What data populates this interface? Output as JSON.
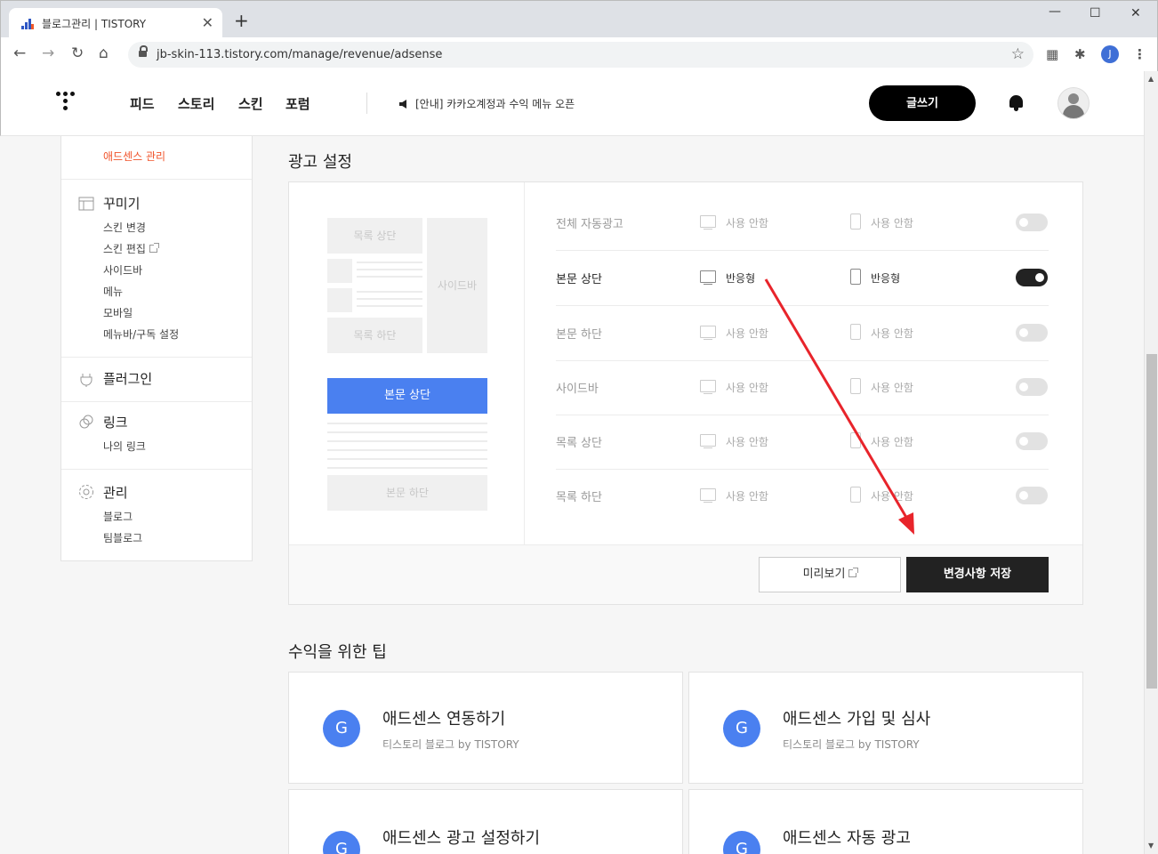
{
  "browser": {
    "tab_title": "블로그관리 | TISTORY",
    "tab_close": "✕",
    "new_tab": "+",
    "url": "jb-skin-113.tistory.com/manage/revenue/adsense",
    "profile_initial": "J",
    "minimize": "—",
    "maximize": "☐",
    "close": "✕"
  },
  "header": {
    "nav": [
      "피드",
      "스토리",
      "스킨",
      "포럼"
    ],
    "notice": "[안내] 카카오계정과 수익 메뉴 오픈",
    "write_button": "글쓰기"
  },
  "sidebar": {
    "active_item": "애드센스 관리",
    "sections": [
      {
        "title": "꾸미기",
        "icon": "layout-icon",
        "items": [
          "스킨 변경",
          "스킨 편집",
          "사이드바",
          "메뉴",
          "모바일",
          "메뉴바/구독 설정"
        ]
      },
      {
        "title": "플러그인",
        "icon": "plug-icon",
        "items": []
      },
      {
        "title": "링크",
        "icon": "link-icon",
        "items": [
          "나의 링크"
        ]
      },
      {
        "title": "관리",
        "icon": "gear-icon",
        "items": [
          "블로그",
          "팀블로그"
        ]
      }
    ]
  },
  "ad_settings": {
    "title": "광고 설정",
    "preview": {
      "list_top": "목록 상단",
      "sidebar": "사이드바",
      "list_bottom": "목록 하단",
      "body_top": "본문 상단",
      "body_bottom": "본문 하단"
    },
    "rows": [
      {
        "name": "전체 자동광고",
        "pc": "사용 안함",
        "mobile": "사용 안함",
        "on": false
      },
      {
        "name": "본문 상단",
        "pc": "반응형",
        "mobile": "반응형",
        "on": true
      },
      {
        "name": "본문 하단",
        "pc": "사용 안함",
        "mobile": "사용 안함",
        "on": false
      },
      {
        "name": "사이드바",
        "pc": "사용 안함",
        "mobile": "사용 안함",
        "on": false
      },
      {
        "name": "목록 상단",
        "pc": "사용 안함",
        "mobile": "사용 안함",
        "on": false
      },
      {
        "name": "목록 하단",
        "pc": "사용 안함",
        "mobile": "사용 안함",
        "on": false
      }
    ],
    "preview_button": "미리보기",
    "save_button": "변경사항 저장"
  },
  "tips": {
    "title": "수익을 위한 팁",
    "icon_letter": "G",
    "cards": [
      {
        "title": "애드센스 연동하기",
        "sub": "티스토리 블로그 by TISTORY"
      },
      {
        "title": "애드센스 가입 및 심사",
        "sub": "티스토리 블로그 by TISTORY"
      },
      {
        "title": "애드센스 광고 설정하기",
        "sub": ""
      },
      {
        "title": "애드센스 자동 광고",
        "sub": ""
      }
    ]
  },
  "annotation": {
    "color": "#e8242b"
  }
}
